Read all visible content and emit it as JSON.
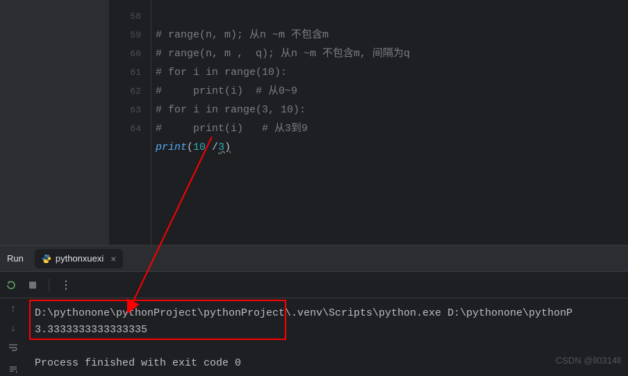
{
  "editor": {
    "line_numbers": [
      "58",
      "59",
      "60",
      "61",
      "62",
      "63",
      "64"
    ],
    "lines": {
      "l58": "# range(n, m); 从n ~m 不包含m",
      "l59": "# range(n, m ,  q); 从n ~m 不包含m, 间隔为q",
      "l60": "# for i in range(10):",
      "l61": "#     print(i)  # 从0~9",
      "l62": "# for i in range(3, 10):",
      "l63": "#     print(i)   # 从3到9"
    },
    "l64": {
      "fn": "print",
      "open": "(",
      "num1": "10",
      "op": " /",
      "num2": "3",
      "close": ")"
    }
  },
  "run": {
    "label": "Run",
    "tab_name": "pythonxuexi"
  },
  "console": {
    "line1": "D:\\pythonone\\pythonProject\\pythonProject\\.venv\\Scripts\\python.exe D:\\pythonone\\pythonP",
    "line2": "3.3333333333333335",
    "line3": "",
    "line4": "Process finished with exit code 0"
  },
  "watermark": "CSDN @ll0314ll",
  "icons": {
    "python": "python-icon",
    "close": "close-icon",
    "restart": "restart-icon",
    "stop": "stop-icon",
    "more": "more-icon",
    "up": "up-arrow-icon",
    "down": "down-arrow-icon",
    "wrap": "wrap-icon",
    "scroll": "scroll-icon"
  }
}
